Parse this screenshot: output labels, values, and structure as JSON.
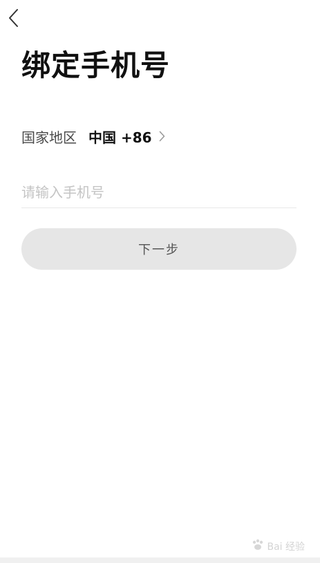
{
  "header": {
    "title": "绑定手机号"
  },
  "region": {
    "label": "国家地区",
    "country": "中国",
    "dial_code": "+86",
    "value": "中国 +86"
  },
  "phone": {
    "placeholder": "请输入手机号",
    "value": ""
  },
  "actions": {
    "next_label": "下一步"
  },
  "watermark": {
    "text": "Bai 经验"
  },
  "colors": {
    "background": "#ffffff",
    "title": "#111111",
    "button_bg": "#e6e6e6",
    "button_text": "#555555",
    "placeholder": "#c4c4c4"
  },
  "icons": {
    "back": "chevron-left-icon",
    "region": "chevron-right-icon",
    "watermark": "paw-icon"
  }
}
